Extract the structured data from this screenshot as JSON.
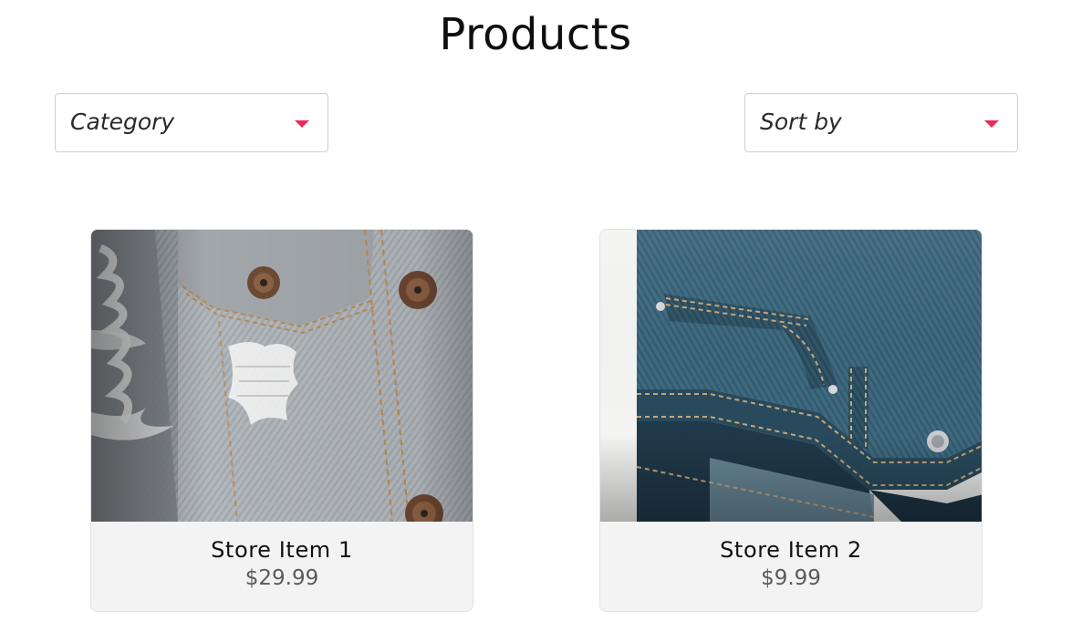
{
  "page": {
    "title": "Products"
  },
  "filters": {
    "category": {
      "label": "Category"
    },
    "sort": {
      "label": "Sort by"
    }
  },
  "theme": {
    "accent": "#ee2a5c",
    "text": "#111111",
    "muted": "#5a5a5a",
    "card_bg": "#f3f3f3",
    "border": "#cfcfcf"
  },
  "products": [
    {
      "name": "Store Item 1",
      "price": "$29.99",
      "image_icon": "denim-jacket-image"
    },
    {
      "name": "Store Item 2",
      "price": "$9.99",
      "image_icon": "denim-jeans-image"
    }
  ]
}
